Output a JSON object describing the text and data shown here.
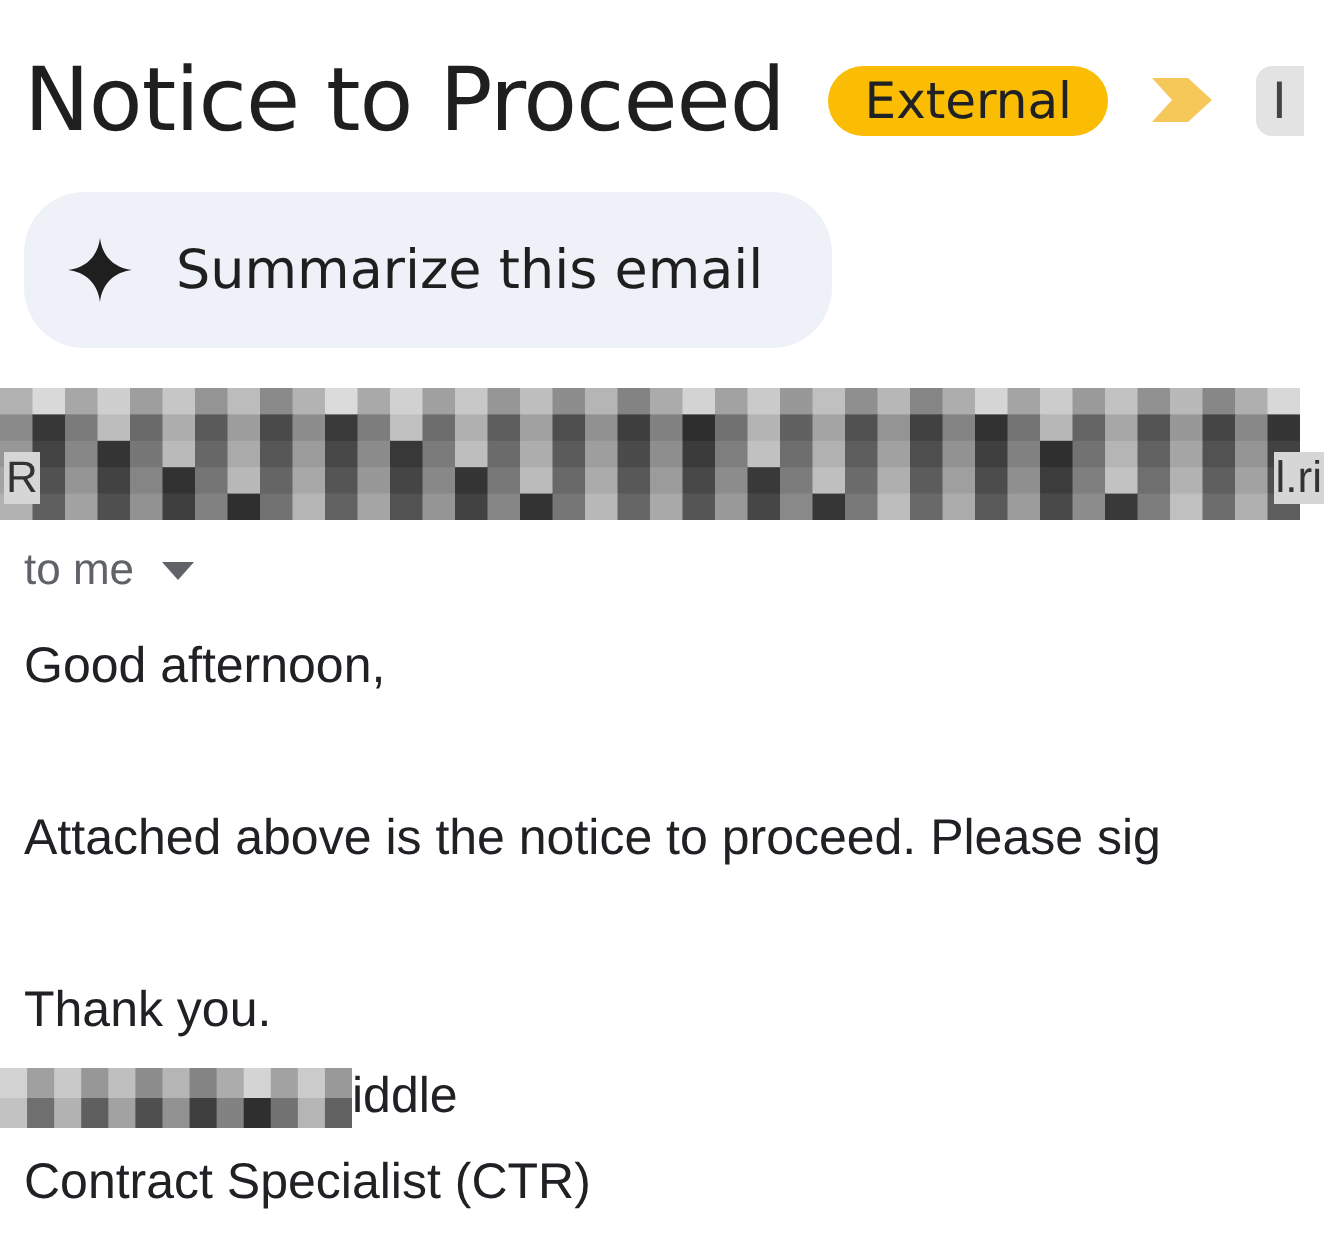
{
  "subject": "Notice to Proceed",
  "labels": [
    {
      "kind": "badge",
      "text": "External"
    },
    {
      "kind": "importance"
    },
    {
      "kind": "chip",
      "text": "I"
    }
  ],
  "summarize_button": {
    "label": "Summarize this email"
  },
  "sender": {
    "start": "R",
    "end": "l.ri"
  },
  "recipient": {
    "label": "to me",
    "expanded": false
  },
  "body": [
    {
      "kind": "line",
      "text": "Good afternoon,"
    },
    {
      "kind": "gap"
    },
    {
      "kind": "line",
      "text": "Attached above is the notice to proceed. Please sig"
    },
    {
      "kind": "gap"
    },
    {
      "kind": "line",
      "text": "Thank you."
    },
    {
      "kind": "redacted",
      "text": "iddle"
    },
    {
      "kind": "line",
      "text": "Contract Specialist (CTR)"
    }
  ]
}
